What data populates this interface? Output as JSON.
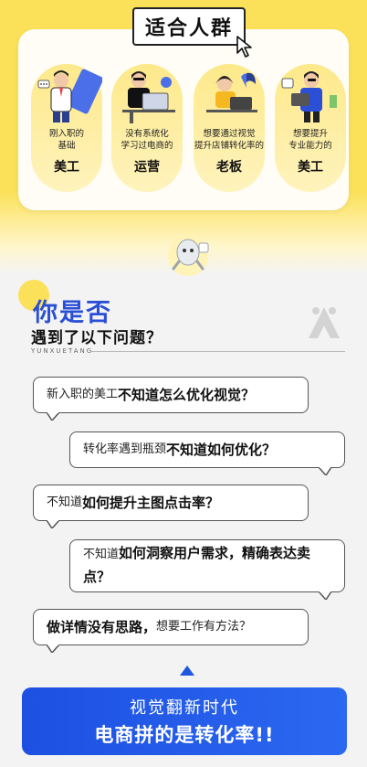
{
  "header": {
    "title": "适合人群"
  },
  "personas": [
    {
      "desc": "刚入职的\n基础",
      "role": "美工"
    },
    {
      "desc": "没有系统化\n学习过电商的",
      "role": "运营"
    },
    {
      "desc": "想要通过视觉\n提升店铺转化率的",
      "role": "老板"
    },
    {
      "desc": "想要提升\n专业能力的",
      "role": "美工"
    }
  ],
  "questions": {
    "title": "你是否",
    "subtitle": "遇到了以下问题？",
    "brand": "YUNXUETANG",
    "items": [
      {
        "plain": "新入职的美工",
        "bold": "不知道怎么优化视觉？"
      },
      {
        "plain": "转化率遇到瓶颈",
        "bold": "不知道如何优化？"
      },
      {
        "plain": "不知道",
        "bold": "如何提升主图点击率？"
      },
      {
        "plain": "不知道",
        "bold": "如何洞察用户需求，精确表达卖点？"
      },
      {
        "bold": "做详情没有思路，",
        "plain": "想要工作有方法？"
      }
    ]
  },
  "cta": {
    "line1": "视觉翻新时代",
    "line2": "电商拼的是转化率!!"
  },
  "colors": {
    "yellow": "#fbe15a",
    "blue": "#1e56e0",
    "title_blue": "#2a4fd6"
  }
}
